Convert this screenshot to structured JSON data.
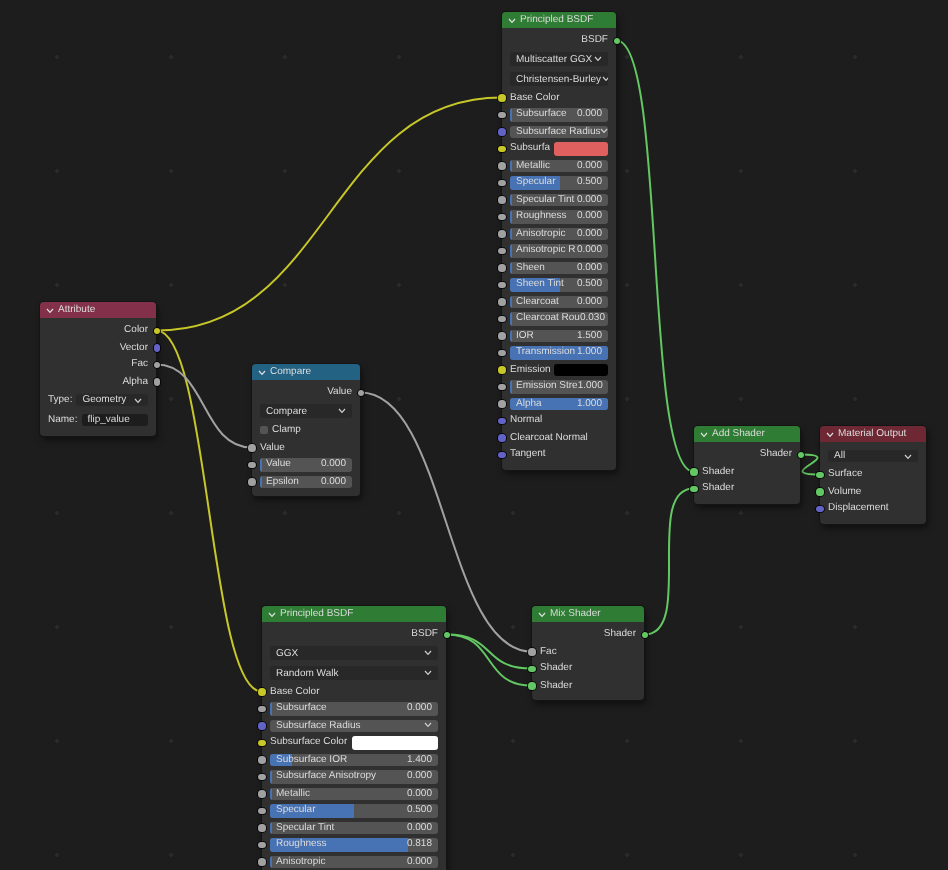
{
  "nodes": [
    {
      "kind": "shader",
      "title": "Principled BSDF",
      "rows": [
        {
          "kind": "output",
          "label": "BSDF",
          "color": "#63c763"
        },
        {
          "kind": "select",
          "value": "Multiscatter GGX"
        },
        {
          "kind": "select",
          "value": "Christensen-Burley"
        },
        {
          "kind": "input",
          "label": "Base Color",
          "color": "#c7c729"
        },
        {
          "kind": "slider",
          "label": "Subsurface",
          "value": "0.000",
          "level": 0,
          "color": "#a1a1a1"
        },
        {
          "kind": "vector_select",
          "label": "Subsurface Radius",
          "color": "#6363c7"
        },
        {
          "kind": "swatch",
          "label": "Subsurfa",
          "swatch": {
            "color": "#e06060"
          },
          "color": "#c7c729"
        },
        {
          "kind": "slider",
          "label": "Metallic",
          "value": "0.000",
          "level": 0,
          "color": "#a1a1a1"
        },
        {
          "kind": "slider",
          "label": "Specular",
          "value": "0.500",
          "level": 0.5,
          "color": "#a1a1a1"
        },
        {
          "kind": "slider",
          "label": "Specular Tint",
          "value": "0.000",
          "level": 0,
          "color": "#a1a1a1"
        },
        {
          "kind": "slider",
          "label": "Roughness",
          "value": "0.000",
          "level": 0,
          "color": "#a1a1a1"
        },
        {
          "kind": "slider",
          "label": "Anisotropic",
          "value": "0.000",
          "level": 0,
          "color": "#a1a1a1"
        },
        {
          "kind": "slider",
          "label": "Anisotropic R",
          "value": "0.000",
          "level": 0,
          "color": "#a1a1a1"
        },
        {
          "kind": "slider",
          "label": "Sheen",
          "value": "0.000",
          "level": 0,
          "color": "#a1a1a1"
        },
        {
          "kind": "slider",
          "label": "Sheen Tint",
          "value": "0.500",
          "level": 0.5,
          "color": "#a1a1a1"
        },
        {
          "kind": "slider",
          "label": "Clearcoat",
          "value": "0.000",
          "level": 0,
          "color": "#a1a1a1"
        },
        {
          "kind": "slider",
          "label": "Clearcoat Rou",
          "value": "0.030",
          "level": 0.03,
          "color": "#a1a1a1"
        },
        {
          "kind": "slider",
          "label": "IOR",
          "value": "1.500",
          "level": 0,
          "color": "#a1a1a1"
        },
        {
          "kind": "slider",
          "label": "Transmission",
          "value": "1.000",
          "level": 1,
          "color": "#a1a1a1"
        },
        {
          "kind": "swatch",
          "label": "Emission",
          "swatch": {
            "color": "#000000"
          },
          "color": "#c7c729"
        },
        {
          "kind": "slider",
          "label": "Emission Stre",
          "value": "1.000",
          "level": 0,
          "color": "#a1a1a1"
        },
        {
          "kind": "slider",
          "label": "Alpha",
          "value": "1.000",
          "level": 1,
          "color": "#a1a1a1"
        },
        {
          "kind": "input",
          "label": "Normal",
          "color": "#6363c7"
        },
        {
          "kind": "input",
          "label": "Clearcoat Normal",
          "color": "#6363c7"
        },
        {
          "kind": "input",
          "label": "Tangent",
          "color": "#6363c7"
        }
      ]
    },
    {
      "kind": "input",
      "title": "Attribute",
      "rows": [
        {
          "kind": "output",
          "label": "Color",
          "color": "#c7c729"
        },
        {
          "kind": "output",
          "label": "Vector",
          "color": "#6363c7"
        },
        {
          "kind": "output",
          "label": "Fac",
          "color": "#a1a1a1"
        },
        {
          "kind": "output",
          "label": "Alpha",
          "color": "#a1a1a1"
        },
        {
          "kind": "select",
          "label": "Type:",
          "value": "Geometry"
        },
        {
          "kind": "text_field",
          "label": "Name:",
          "value": "flip_value"
        }
      ]
    },
    {
      "kind": "converter",
      "title": "Compare",
      "rows": [
        {
          "kind": "output",
          "label": "Value",
          "color": "#a1a1a1"
        },
        {
          "kind": "select",
          "value": "Compare"
        },
        {
          "kind": "checkbox",
          "label": "Clamp",
          "checked": false
        },
        {
          "kind": "input",
          "label": "Value",
          "color": "#a1a1a1"
        },
        {
          "kind": "slider",
          "label": "Value",
          "value": "0.000",
          "level": 0,
          "color": "#a1a1a1"
        },
        {
          "kind": "slider",
          "label": "Epsilon",
          "value": "0.000",
          "level": 0,
          "color": "#a1a1a1"
        }
      ]
    },
    {
      "kind": "shader",
      "title": "Add Shader",
      "rows": [
        {
          "kind": "output",
          "label": "Shader",
          "color": "#63c763"
        },
        {
          "kind": "input",
          "label": "Shader",
          "color": "#63c763"
        },
        {
          "kind": "input",
          "label": "Shader",
          "color": "#63c763"
        }
      ]
    },
    {
      "kind": "output",
      "title": "Material Output",
      "rows": [
        {
          "kind": "select",
          "value": "All"
        },
        {
          "kind": "input",
          "label": "Surface",
          "color": "#63c763"
        },
        {
          "kind": "input",
          "label": "Volume",
          "color": "#63c763"
        },
        {
          "kind": "input",
          "label": "Displacement",
          "color": "#6363c7"
        }
      ]
    },
    {
      "kind": "shader",
      "title": "Principled BSDF",
      "rows": [
        {
          "kind": "output",
          "label": "BSDF",
          "color": "#63c763"
        },
        {
          "kind": "select",
          "value": "GGX"
        },
        {
          "kind": "select",
          "value": "Random Walk"
        },
        {
          "kind": "input",
          "label": "Base Color",
          "color": "#c7c729"
        },
        {
          "kind": "slider",
          "label": "Subsurface",
          "value": "0.000",
          "level": 0,
          "color": "#a1a1a1"
        },
        {
          "kind": "vector_select",
          "label": "Subsurface Radius",
          "color": "#6363c7"
        },
        {
          "kind": "swatch",
          "label": "Subsurface Color",
          "swatch": {
            "color": "#ffffff"
          },
          "color": "#c7c729"
        },
        {
          "kind": "slider",
          "label": "Subsurface IOR",
          "value": "1.400",
          "level": 0.13,
          "color": "#a1a1a1"
        },
        {
          "kind": "slider",
          "label": "Subsurface Anisotropy",
          "value": "0.000",
          "level": 0,
          "color": "#a1a1a1"
        },
        {
          "kind": "slider",
          "label": "Metallic",
          "value": "0.000",
          "level": 0,
          "color": "#a1a1a1"
        },
        {
          "kind": "slider",
          "label": "Specular",
          "value": "0.500",
          "level": 0.5,
          "color": "#a1a1a1"
        },
        {
          "kind": "slider",
          "label": "Specular Tint",
          "value": "0.000",
          "level": 0,
          "color": "#a1a1a1"
        },
        {
          "kind": "slider",
          "label": "Roughness",
          "value": "0.818",
          "level": 0.818,
          "color": "#a1a1a1"
        },
        {
          "kind": "slider",
          "label": "Anisotropic",
          "value": "0.000",
          "level": 0,
          "color": "#a1a1a1"
        }
      ]
    },
    {
      "kind": "shader",
      "title": "Mix Shader",
      "rows": [
        {
          "kind": "output",
          "label": "Shader",
          "color": "#63c763"
        },
        {
          "kind": "input",
          "label": "Fac",
          "color": "#a1a1a1"
        },
        {
          "kind": "input",
          "label": "Shader",
          "color": "#63c763"
        },
        {
          "kind": "input",
          "label": "Shader",
          "color": "#63c763"
        }
      ]
    }
  ]
}
